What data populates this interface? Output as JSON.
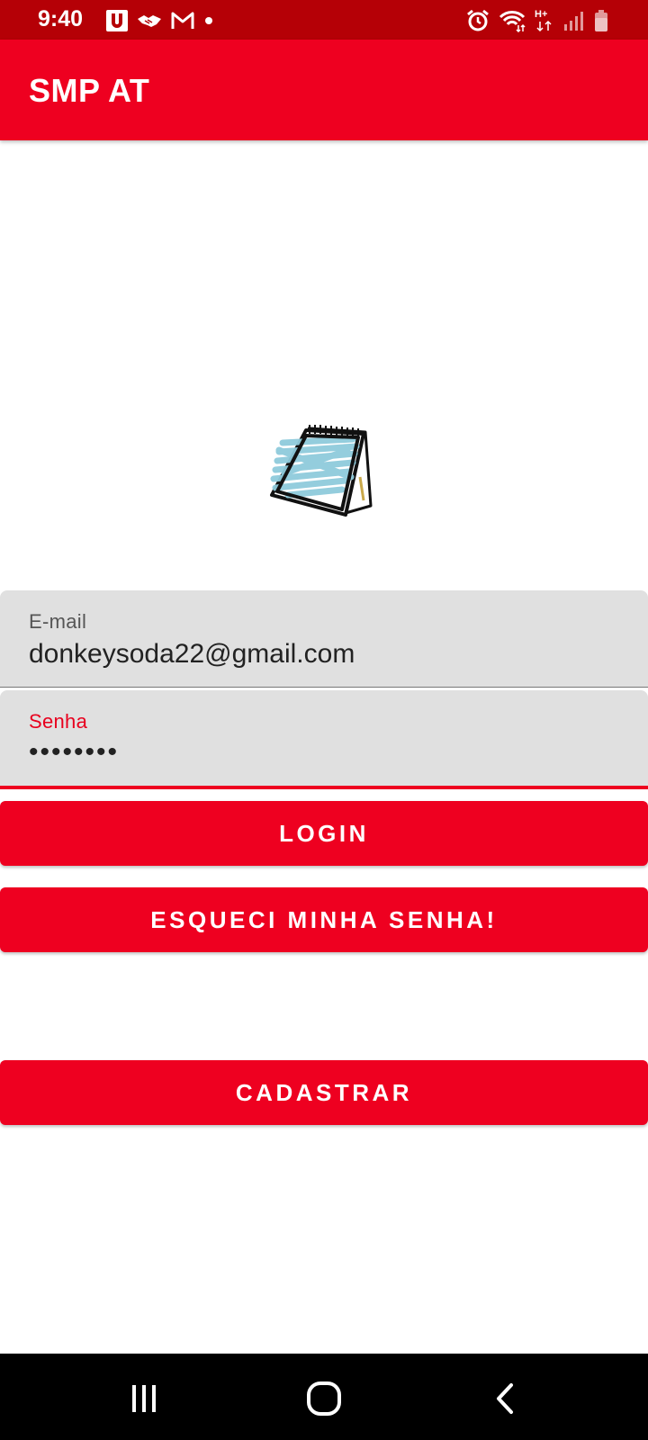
{
  "status_bar": {
    "time": "9:40",
    "left_icons": [
      "u-app-icon",
      "handshake-icon",
      "gmail-icon",
      "dot-icon"
    ],
    "right_icons": [
      "alarm-icon",
      "wifi-icon",
      "network-type-icon",
      "signal-icon",
      "battery-icon"
    ],
    "network_type": "H+"
  },
  "app_bar": {
    "title": "SMP AT",
    "color": "#ee0020"
  },
  "logo": {
    "icon": "notepad-icon"
  },
  "form": {
    "email": {
      "label": "E-mail",
      "value": "donkeysoda22@gmail.com"
    },
    "password": {
      "label": "Senha",
      "value": "••••••••"
    }
  },
  "buttons": {
    "login": "LOGIN",
    "forgot_password": "ESQUECI MINHA SENHA!",
    "register": "CADASTRAR"
  },
  "nav_bar": {
    "icons": [
      "recents-icon",
      "home-icon",
      "back-icon"
    ]
  },
  "colors": {
    "status_bar": "#b50006",
    "accent": "#ee0020",
    "field_bg": "#e0e0e0"
  }
}
